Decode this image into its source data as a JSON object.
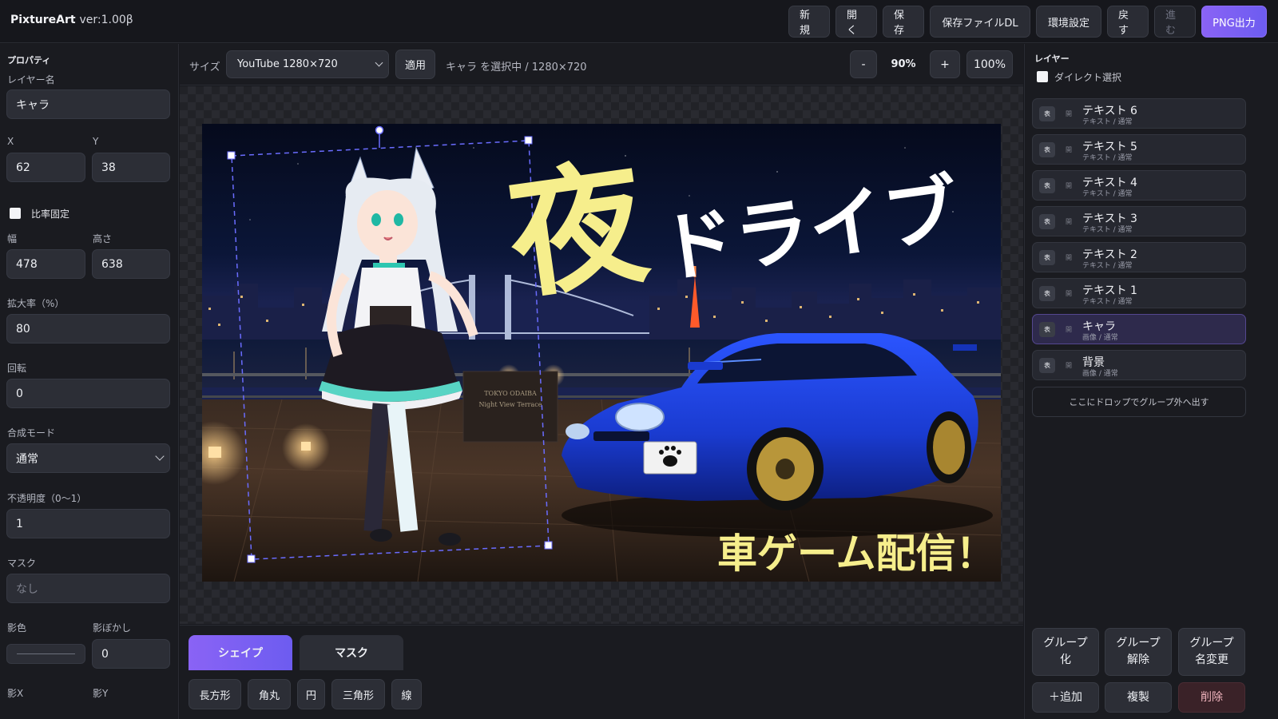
{
  "app": {
    "title": "PixtureArt",
    "version": "ver:1.00β"
  },
  "toolbar": {
    "new": "新規",
    "open": "開く",
    "save": "保存",
    "save_file_dl": "保存ファイルDL",
    "settings": "環境設定",
    "undo": "戻す",
    "redo": "進む",
    "png_export": "PNG出力"
  },
  "properties": {
    "heading": "プロパティ",
    "layer_name_label": "レイヤー名",
    "layer_name": "キャラ",
    "x_label": "X",
    "x": "62",
    "y_label": "Y",
    "y": "38",
    "ratio_lock_label": "比率固定",
    "ratio_lock": false,
    "width_label": "幅",
    "width": "478",
    "height_label": "高さ",
    "height": "638",
    "scale_label": "拡大率（%）",
    "scale": "80",
    "rotation_label": "回転",
    "rotation": "0",
    "blend_label": "合成モード",
    "blend": "通常",
    "opacity_label": "不透明度（0〜1）",
    "opacity": "1",
    "mask_label": "マスク",
    "mask": "なし",
    "shadow_color_label": "影色",
    "shadow_blur_label": "影ぼかし",
    "shadow_blur": "0",
    "shadow_x_label": "影X",
    "shadow_y_label": "影Y"
  },
  "canvas_toolbar": {
    "size_label": "サイズ",
    "size_value": "YouTube 1280×720",
    "apply": "適用",
    "status": "キャラ を選択中 / 1280×720",
    "zoom_out": "-",
    "zoom": "90%",
    "zoom_in": "+",
    "zoom_reset": "100%"
  },
  "artboard": {
    "title_kanji": "夜",
    "title_kana": "ドライブ",
    "subtitle": "車ゲーム配信！",
    "monument_line1": "TOKYO ODAIBA",
    "monument_line2": "Night View Terrace"
  },
  "bottom_tabs": {
    "shape": "シェイプ",
    "mask": "マスク"
  },
  "shapes": {
    "rect": "長方形",
    "rounded": "角丸",
    "circle": "円",
    "triangle": "三角形",
    "line": "線"
  },
  "layers": {
    "heading": "レイヤー",
    "direct_select_label": "ダイレクト選択",
    "show_badge": "表",
    "lock_badge": "開",
    "items": [
      {
        "name": "テキスト 6",
        "sub": "テキスト / 通常"
      },
      {
        "name": "テキスト 5",
        "sub": "テキスト / 通常"
      },
      {
        "name": "テキスト 4",
        "sub": "テキスト / 通常"
      },
      {
        "name": "テキスト 3",
        "sub": "テキスト / 通常"
      },
      {
        "name": "テキスト 2",
        "sub": "テキスト / 通常"
      },
      {
        "name": "テキスト 1",
        "sub": "テキスト / 通常"
      },
      {
        "name": "キャラ",
        "sub": "画像 / 通常"
      },
      {
        "name": "背景",
        "sub": "画像 / 通常"
      }
    ],
    "drop_out": "ここにドロップでグループ外へ出す"
  },
  "layer_actions": {
    "group": "グループ\n化",
    "ungroup": "グループ\n解除",
    "rename_group": "グループ\n名変更",
    "add": "＋追加",
    "duplicate": "複製",
    "delete": "削除"
  },
  "colors": {
    "accent": "#7c5cf2",
    "panel": "#1a1b20",
    "field": "#2c2e36",
    "title_yellow": "#f6ee8c",
    "car_blue": "#1d3fd6"
  }
}
